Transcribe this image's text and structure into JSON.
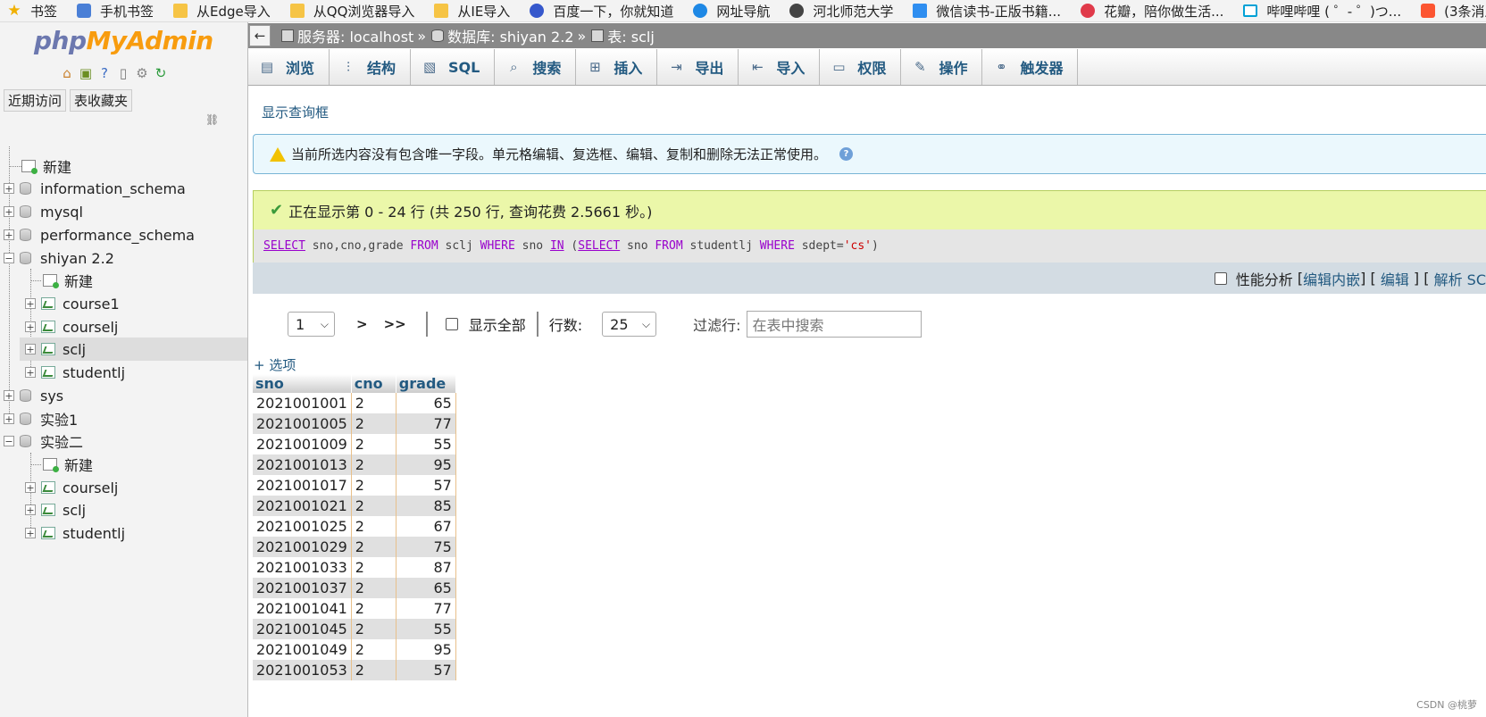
{
  "bookmarks": [
    {
      "label": "书签",
      "icon": "star-icon"
    },
    {
      "label": "手机书签",
      "icon": "phone-bookmark-icon"
    },
    {
      "label": "从Edge导入",
      "icon": "folder-icon"
    },
    {
      "label": "从QQ浏览器导入",
      "icon": "folder-icon"
    },
    {
      "label": "从IE导入",
      "icon": "folder-icon"
    },
    {
      "label": "百度一下，你就知道",
      "icon": "baidu-icon"
    },
    {
      "label": "网址导航",
      "icon": "navigation-icon"
    },
    {
      "label": "河北师范大学",
      "icon": "university-icon"
    },
    {
      "label": "微信读书-正版书籍...",
      "icon": "weread-icon"
    },
    {
      "label": "花瓣，陪你做生活...",
      "icon": "huaban-icon"
    },
    {
      "label": "哔哩哔哩 ( ゜- ゜)つ...",
      "icon": "bilibili-icon"
    },
    {
      "label": "(3条消息",
      "icon": "csdn-icon"
    }
  ],
  "left": {
    "logo_a": "php",
    "logo_b": "MyAdmin",
    "tab_recent": "近期访问",
    "tab_favorites": "表收藏夹",
    "tree": {
      "new_root": "新建",
      "information_schema": "information_schema",
      "mysql": "mysql",
      "performance_schema": "performance_schema",
      "shiyan": "shiyan 2.2",
      "shiyan_new": "新建",
      "course1": "course1",
      "coursel_j": "courselj",
      "sclj": "sclj",
      "studentlj": "studentlj",
      "sys": "sys",
      "exp1": "实验1",
      "exp2": "实验二",
      "exp2_new": "新建",
      "exp2_courselj": "courselj",
      "exp2_sclj": "sclj",
      "exp2_studentlj": "studentlj"
    }
  },
  "breadcrumb": {
    "server": "服务器: localhost",
    "database": "数据库: shiyan 2.2",
    "table": "表: sclj",
    "separator": "»"
  },
  "tabs": [
    "浏览",
    "结构",
    "SQL",
    "搜索",
    "插入",
    "导出",
    "导入",
    "权限",
    "操作",
    "触发器"
  ],
  "show_query_link": "显示查询框",
  "notice_text": "当前所选内容没有包含唯一字段。单元格编辑、复选框、编辑、复制和删除无法正常使用。",
  "success_text": "正在显示第 0 - 24 行 (共 250 行, 查询花费 2.5661 秒。)",
  "sql": {
    "t1": "SELECT",
    "t2": " sno,cno,grade ",
    "t3": "FROM",
    "t4": " sclj ",
    "t5": "WHERE",
    "t6": " sno ",
    "t7": "IN",
    "t8": " (",
    "t9": "SELECT",
    "t10": " sno ",
    "t11": "FROM",
    "t12": " studentlj ",
    "t13": "WHERE",
    "t14": " sdept=",
    "t15": "'cs'",
    "t16": ")"
  },
  "profile": {
    "label": "性能分析",
    "lb1": " [",
    "edit_inline": "编辑内嵌",
    "rb1": "] [ ",
    "edit": "编辑",
    "rb2": " ] [ ",
    "explain": "解析 SC"
  },
  "pagination": {
    "page": "1",
    "next": ">",
    "last": ">>",
    "show_all": "显示全部",
    "rows_label": "行数:",
    "rows_value": "25",
    "filter_label": "过滤行:",
    "filter_placeholder": "在表中搜索"
  },
  "options_link": "+ 选项",
  "table": {
    "columns": [
      "sno",
      "cno",
      "grade"
    ],
    "rows": [
      [
        "2021001001",
        "2",
        "65"
      ],
      [
        "2021001005",
        "2",
        "77"
      ],
      [
        "2021001009",
        "2",
        "55"
      ],
      [
        "2021001013",
        "2",
        "95"
      ],
      [
        "2021001017",
        "2",
        "57"
      ],
      [
        "2021001021",
        "2",
        "85"
      ],
      [
        "2021001025",
        "2",
        "67"
      ],
      [
        "2021001029",
        "2",
        "75"
      ],
      [
        "2021001033",
        "2",
        "87"
      ],
      [
        "2021001037",
        "2",
        "65"
      ],
      [
        "2021001041",
        "2",
        "77"
      ],
      [
        "2021001045",
        "2",
        "55"
      ],
      [
        "2021001049",
        "2",
        "95"
      ],
      [
        "2021001053",
        "2",
        "57"
      ]
    ]
  },
  "watermark": "CSDN @桃萝"
}
